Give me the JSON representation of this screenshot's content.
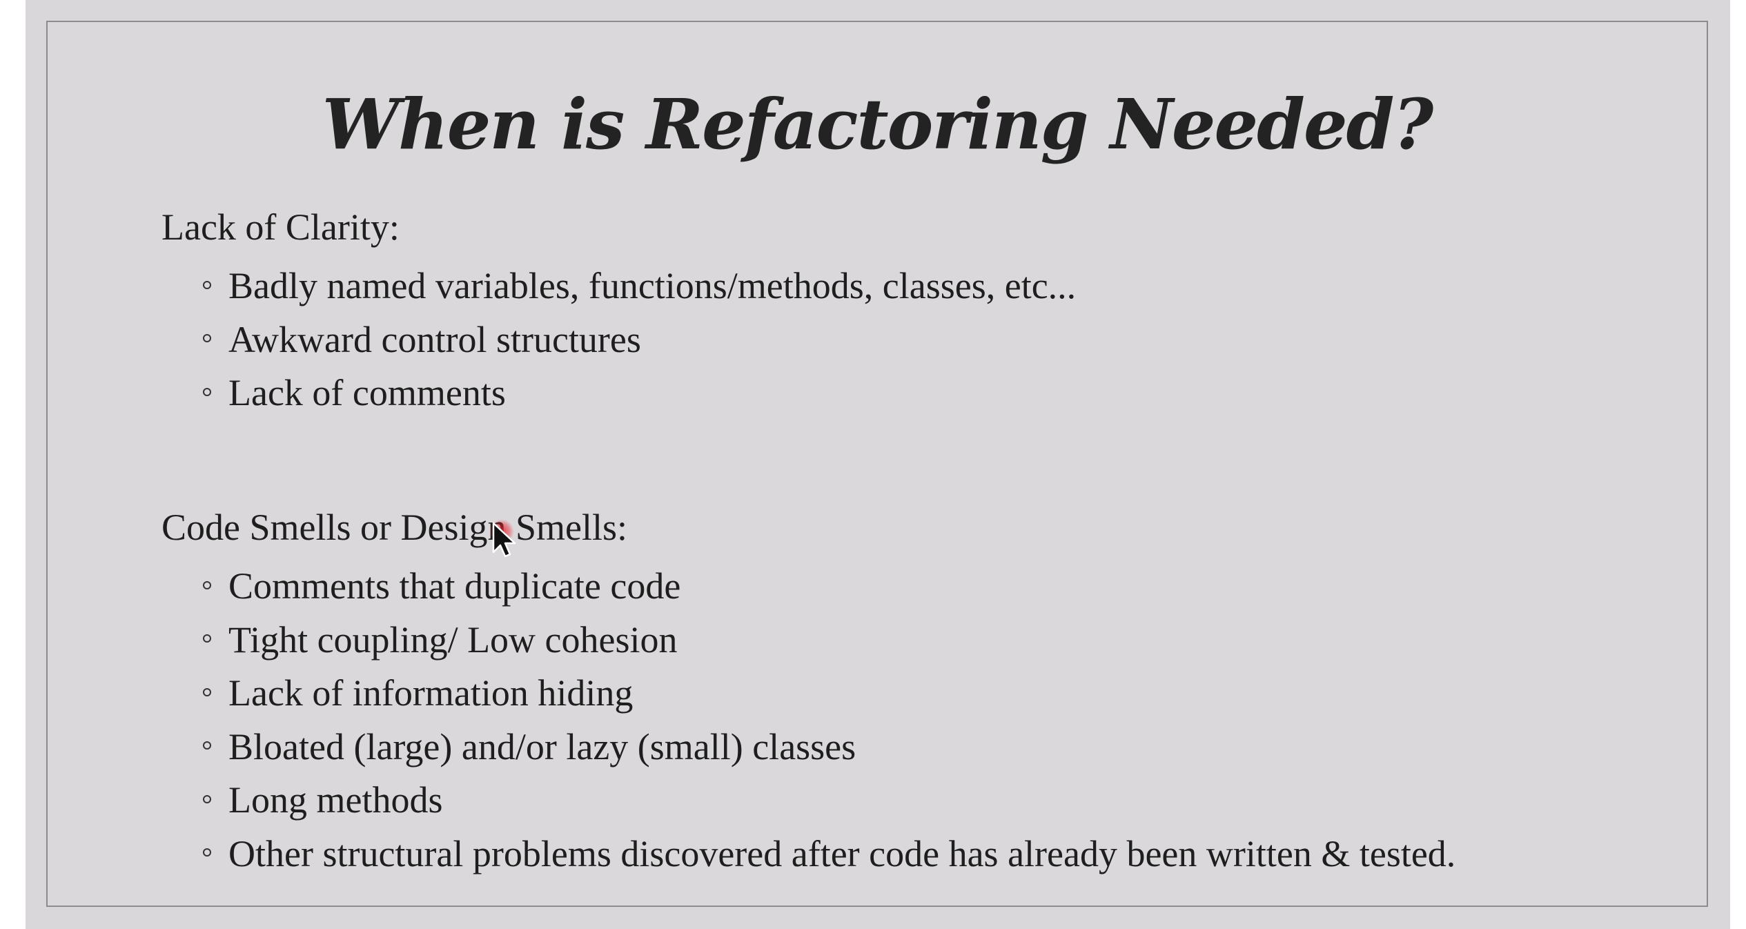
{
  "slide": {
    "title": "When is Refactoring Needed?",
    "sections": [
      {
        "heading": "Lack of Clarity:",
        "items": [
          "Badly named variables, functions/methods, classes, etc...",
          "Awkward control structures",
          "Lack of comments"
        ]
      },
      {
        "heading": "Code Smells or Design Smells:",
        "items": [
          "Comments that duplicate code",
          "Tight coupling/ Low cohesion",
          "Lack of information hiding",
          "Bloated (large) and/or lazy (small) classes",
          "Long methods",
          "Other structural problems discovered after code has already been written & tested."
        ]
      }
    ]
  },
  "colors": {
    "background": "#d9d7da",
    "text": "#1e1e1e",
    "border": "#8d8b8e",
    "cursor_highlight": "#e61e28"
  }
}
